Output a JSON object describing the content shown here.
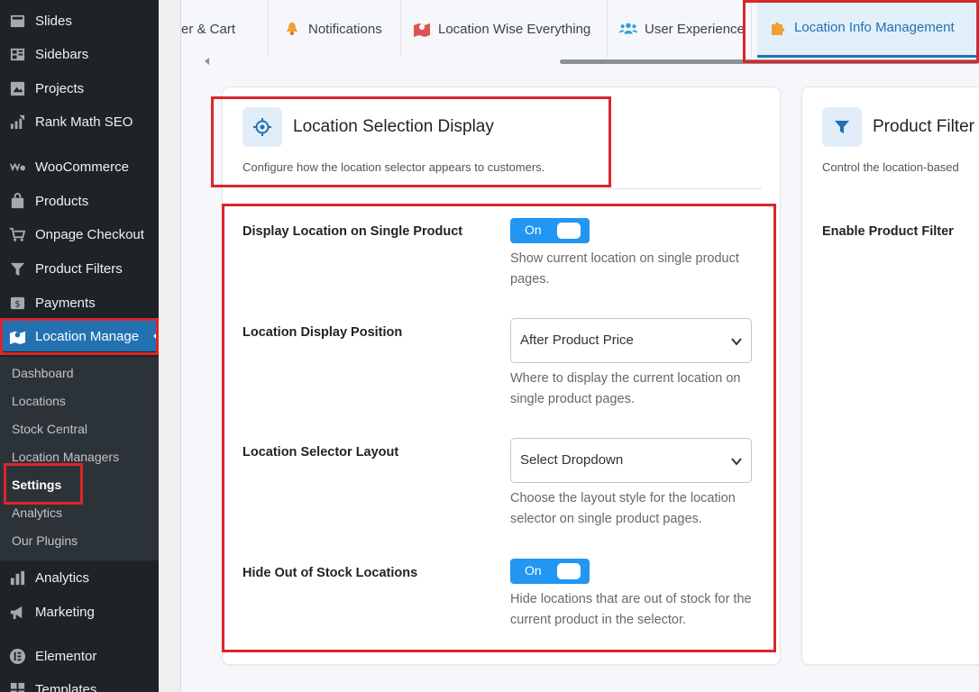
{
  "sidebar": {
    "items": [
      {
        "label": "Slides",
        "icon": "slides-icon"
      },
      {
        "label": "Sidebars",
        "icon": "sidebars-icon"
      },
      {
        "label": "Projects",
        "icon": "projects-icon"
      },
      {
        "label": "Rank Math SEO",
        "icon": "rank-math-icon"
      },
      {
        "label": "WooCommerce",
        "icon": "woocommerce-icon"
      },
      {
        "label": "Products",
        "icon": "products-icon"
      },
      {
        "label": "Onpage Checkout",
        "icon": "cart-icon"
      },
      {
        "label": "Product Filters",
        "icon": "filter-icon"
      },
      {
        "label": "Payments",
        "icon": "payments-icon"
      },
      {
        "label": "Location Manage",
        "icon": "location-map-icon"
      },
      {
        "label": "Analytics",
        "icon": "analytics-icon"
      },
      {
        "label": "Marketing",
        "icon": "megaphone-icon"
      },
      {
        "label": "Elementor",
        "icon": "elementor-icon"
      },
      {
        "label": "Templates",
        "icon": "templates-icon"
      }
    ],
    "submenu": [
      "Dashboard",
      "Locations",
      "Stock Central",
      "Location Managers",
      "Settings",
      "Analytics",
      "Our Plugins"
    ]
  },
  "tabs": [
    {
      "label": "er & Cart",
      "icon": ""
    },
    {
      "label": "Notifications",
      "icon": "bell-icon"
    },
    {
      "label": "Location Wise Everything",
      "icon": "map-icon"
    },
    {
      "label": "User Experience",
      "icon": "users-icon"
    },
    {
      "label": "Location Info Management",
      "icon": "puzzle-icon"
    }
  ],
  "location_card": {
    "title": "Location Selection Display",
    "description": "Configure how the location selector appears to customers.",
    "settings": {
      "single_product": {
        "label": "Display Location on Single Product",
        "toggle": "On",
        "help": "Show current location on single product pages."
      },
      "position": {
        "label": "Location Display Position",
        "value": "After Product Price",
        "help": "Where to display the current location on single product pages."
      },
      "layout": {
        "label": "Location Selector Layout",
        "value": "Select Dropdown",
        "help": "Choose the layout style for the location selector on single product pages."
      },
      "hide_out_of_stock": {
        "label": "Hide Out of Stock Locations",
        "toggle": "On",
        "help": "Hide locations that are out of stock for the current product in the selector."
      }
    }
  },
  "filter_card": {
    "title": "Product Filter",
    "description": "Control the location-based",
    "setting_label": "Enable Product Filter"
  },
  "colors": {
    "accent": "#2271b1",
    "toggle": "#2196f3",
    "highlight": "#d9262c",
    "sidebar_bg": "#1d2327"
  }
}
